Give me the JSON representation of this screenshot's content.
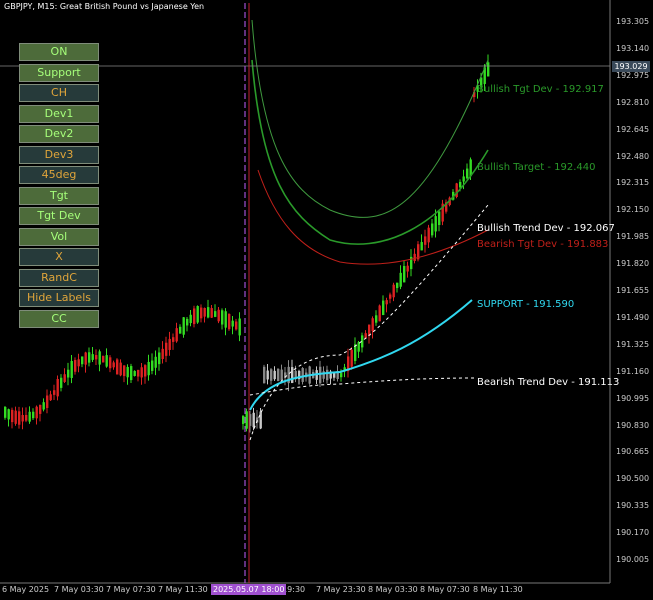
{
  "chart_title": "GBPJPY, M15: Great British Pound vs Japanese Yen",
  "current_price": "193.029",
  "price_axis": [
    "193.305",
    "193.140",
    "192.975",
    "192.810",
    "192.645",
    "192.480",
    "192.315",
    "192.150",
    "191.985",
    "191.820",
    "191.655",
    "191.490",
    "191.325",
    "191.160",
    "190.995",
    "190.830",
    "190.665",
    "190.500",
    "190.335",
    "190.170",
    "190.005"
  ],
  "time_axis": [
    "6 May 2025",
    "7 May 03:30",
    "7 May 07:30",
    "7 May 11:30",
    "May 19:30",
    "7 May 23:30",
    "8 May 03:30",
    "8 May 07:30",
    "8 May 11:30"
  ],
  "highlighted_time": "2025.05.07 18:00",
  "buttons": [
    {
      "label": "ON",
      "style": "green"
    },
    {
      "label": "Support",
      "style": "green"
    },
    {
      "label": "CH",
      "style": "dark"
    },
    {
      "label": "Dev1",
      "style": "green"
    },
    {
      "label": "Dev2",
      "style": "green"
    },
    {
      "label": "Dev3",
      "style": "dark"
    },
    {
      "label": "45deg",
      "style": "dark"
    },
    {
      "label": "Tgt",
      "style": "green"
    },
    {
      "label": "Tgt Dev",
      "style": "green"
    },
    {
      "label": "Vol",
      "style": "green"
    },
    {
      "label": "X",
      "style": "dark"
    },
    {
      "label": "RandC",
      "style": "dark"
    },
    {
      "label": "Hide Labels",
      "style": "dark"
    },
    {
      "label": "CC",
      "style": "green"
    }
  ],
  "levels": [
    {
      "label": "Bullish Tgt Dev - 192.917",
      "color": "#2a9a2a"
    },
    {
      "label": "Bullish Target - 192.440",
      "color": "#2a9a2a"
    },
    {
      "label": "Bullish Trend Dev - 192.067",
      "color": "#ffffff"
    },
    {
      "label": "Bearish Tgt Dev - 191.883",
      "color": "#c0201a"
    },
    {
      "label": "SUPPORT - 191.590",
      "color": "#30d8f0"
    },
    {
      "label": "Bearish Trend Dev - 191.113",
      "color": "#ffffff"
    }
  ],
  "colors": {
    "bull": "#33dd22",
    "bear": "#dd2222",
    "support": "#30d8f0",
    "grid": "#3a3a3a",
    "divider": "#a050d0"
  }
}
